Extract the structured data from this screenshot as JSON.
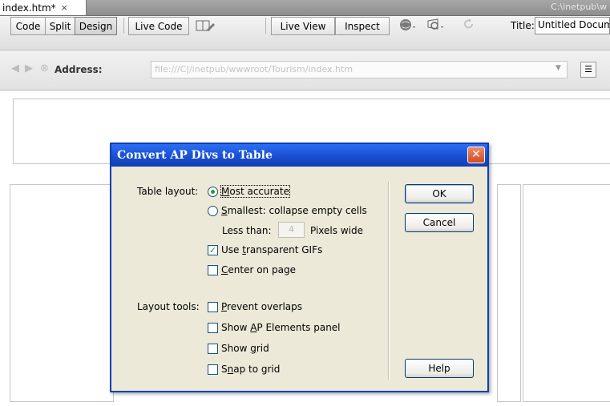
{
  "doc_tab": {
    "filename": "index.htm*",
    "close_glyph": "×",
    "path": "C:\\inetpub\\w"
  },
  "toolbar": {
    "code": "Code",
    "split": "Split",
    "design": "Design",
    "live_code": "Live Code",
    "live_view": "Live View",
    "inspect": "Inspect",
    "title_label": "Title:",
    "title_value": "Untitled Docum"
  },
  "address_bar": {
    "label": "Address:",
    "value": "file:///C|/inetpub/wwwroot/Tourism/index.htm"
  },
  "dialog": {
    "title": "Convert AP Divs to Table",
    "close_glyph": "✕",
    "table_layout_label": "Table layout:",
    "most_accurate": {
      "pre": "",
      "key": "M",
      "post": "ost accurate",
      "selected": true
    },
    "smallest": {
      "pre": "",
      "key": "S",
      "post": "mallest: collapse empty cells",
      "selected": false
    },
    "less_than_label": "Less than:",
    "less_than_value": "4",
    "pixels_wide_label": "Pixels wide",
    "use_transparent_gifs": {
      "pre": "Use ",
      "key": "t",
      "post": "ransparent GIFs",
      "checked": true
    },
    "center_on_page": {
      "pre": "",
      "key": "C",
      "post": "enter on page",
      "checked": false
    },
    "layout_tools_label": "Layout tools:",
    "prevent_overlaps": {
      "pre": "",
      "key": "P",
      "post": "revent overlaps",
      "checked": false
    },
    "show_ap_elements": {
      "pre": "Show ",
      "key": "A",
      "post": "P Elements panel",
      "checked": false
    },
    "show_grid": {
      "pre": "Show ",
      "key": "g",
      "post": "rid",
      "checked": false
    },
    "snap_to_grid": {
      "pre": "S",
      "key": "n",
      "post": "ap to grid",
      "checked": false
    },
    "ok_label": "OK",
    "cancel_label": "Cancel",
    "help_label": "Help"
  },
  "colors": {
    "dialog_titlebar": "#1a4fd1",
    "dialog_body": "#ece9d8",
    "check_green": "#21a121"
  },
  "icons": [
    "close-icon",
    "split-view-icon",
    "globe-icon",
    "refresh-icon",
    "back-icon",
    "forward-icon",
    "stop-icon",
    "home-icon",
    "list-icon"
  ]
}
